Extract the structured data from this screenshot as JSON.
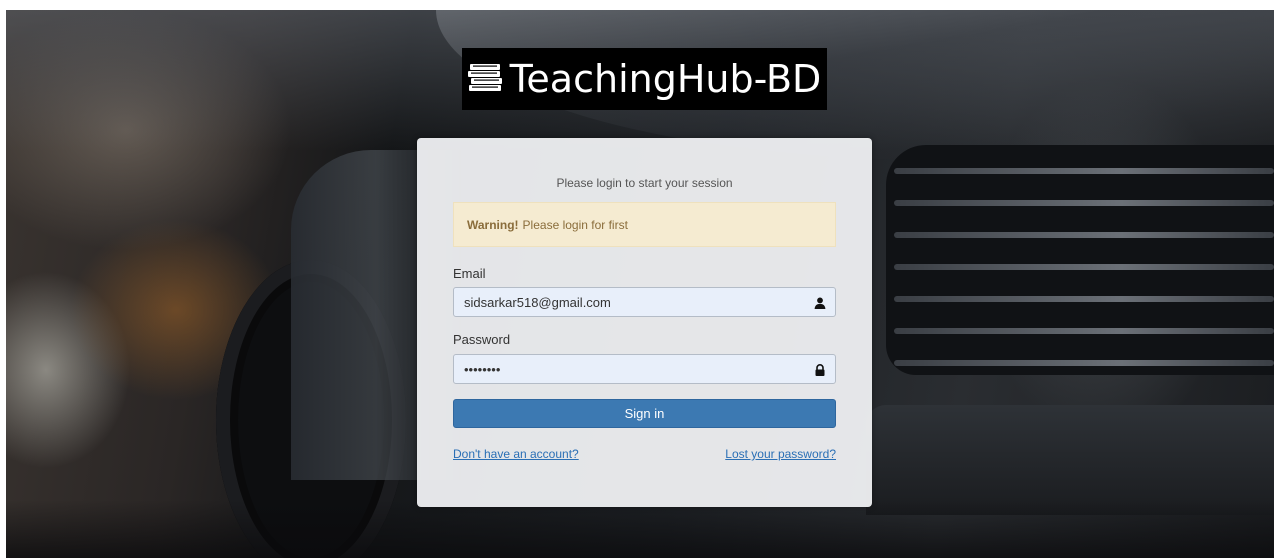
{
  "brand": {
    "name": "TeachingHub-BD",
    "logo_icon": "books-stack-icon"
  },
  "login": {
    "subtitle": "Please login to start your session",
    "alert": {
      "strong": "Warning!",
      "message": "Please login for first",
      "color": "#8a6d3b"
    },
    "email": {
      "label": "Email",
      "value": "sidsarkar518@gmail.com",
      "icon": "user-icon"
    },
    "password": {
      "label": "Password",
      "value": "secretpw",
      "icon": "lock-icon"
    },
    "submit_label": "Sign in",
    "register_link": "Don't have an account?",
    "forgot_link": "Lost your password?"
  },
  "colors": {
    "primary": "#3c79b2",
    "link": "#2a6fb5",
    "alert_bg": "#f5ebd1"
  }
}
